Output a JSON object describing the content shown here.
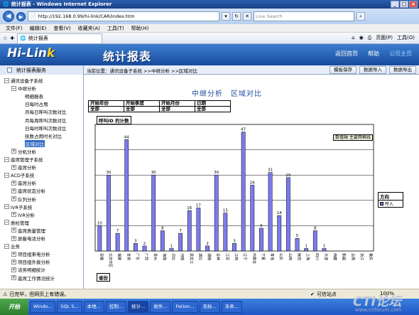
{
  "window": {
    "title": "统计报表 - Windows Internet Explorer"
  },
  "browser": {
    "url": "http://192.168.0.99/hi-link/CAR/index.htm",
    "search_placeholder": "Live Search",
    "menus": [
      "文件(F)",
      "编辑(E)",
      "查看(V)",
      "收藏夹(A)",
      "工具(T)",
      "帮助(H)"
    ],
    "tab_label": "统计报表",
    "tools": {
      "page": "页面(P)",
      "tools": "工具(O)"
    }
  },
  "app": {
    "logo_a": "Hi-Lin",
    "logo_b": "k",
    "title": "统计报表",
    "links": {
      "back": "返回首页",
      "help": "帮助",
      "home": "公司主页"
    }
  },
  "sidebar": {
    "header": "统计报表服务",
    "nodes": [
      {
        "label": "通讯设备子系统",
        "toggle": "⊟",
        "level": 0
      },
      {
        "label": "中继分析",
        "toggle": "⊟",
        "level": 1
      },
      {
        "label": "明细报表",
        "toggle": "",
        "level": 2
      },
      {
        "label": "日每时占用",
        "toggle": "",
        "level": 2
      },
      {
        "label": "月每日呼叫次数对比",
        "toggle": "",
        "level": 2
      },
      {
        "label": "月每周呼叫次数对比",
        "toggle": "",
        "level": 2
      },
      {
        "label": "日每时呼叫次数对比",
        "toggle": "",
        "level": 2
      },
      {
        "label": "统数占用时长对比",
        "toggle": "",
        "level": 2
      },
      {
        "label": "区域对比",
        "toggle": "",
        "level": 2,
        "selected": true
      },
      {
        "label": "分机分析",
        "toggle": "⊞",
        "level": 1
      },
      {
        "label": "座席管理子系统",
        "toggle": "⊟",
        "level": 0
      },
      {
        "label": "座席分析",
        "toggle": "⊞",
        "level": 1
      },
      {
        "label": "ACD子系统",
        "toggle": "⊟",
        "level": 0
      },
      {
        "label": "座席分析",
        "toggle": "⊞",
        "level": 1
      },
      {
        "label": "座席状态分析",
        "toggle": "⊞",
        "level": 1
      },
      {
        "label": "队列分析",
        "toggle": "⊞",
        "level": 1
      },
      {
        "label": "IVR子系统",
        "toggle": "⊟",
        "level": 0
      },
      {
        "label": "IVR分析",
        "toggle": "⊞",
        "level": 1
      },
      {
        "label": "质检管理",
        "toggle": "⊟",
        "level": 0
      },
      {
        "label": "座席质量管理",
        "toggle": "⊞",
        "level": 1
      },
      {
        "label": "屏蔽电话分析",
        "toggle": "⊞",
        "level": 1
      },
      {
        "label": "业务",
        "toggle": "⊟",
        "level": 0
      },
      {
        "label": "项目组来电分析",
        "toggle": "⊞",
        "level": 1
      },
      {
        "label": "项目组外拨分析",
        "toggle": "⊞",
        "level": 1
      },
      {
        "label": "话务明细统计",
        "toggle": "⊞",
        "level": 1
      },
      {
        "label": "座席工作情况统计",
        "toggle": "⊞",
        "level": 1
      }
    ]
  },
  "breadcrumb": {
    "text": "当前位置：通讯设备子系统 >>中继分析 >>区域对比"
  },
  "actions": {
    "save": "模板保存",
    "import": "数据导入",
    "export": "数据导出"
  },
  "filters": {
    "headers": [
      "开始年份",
      "开始季度",
      "开始月份",
      "日期"
    ],
    "values": [
      "全部",
      "全部",
      "全部",
      "全部"
    ]
  },
  "chart_data": {
    "type": "bar",
    "title": "中继分析　区域对比",
    "ylabel": "呼叫ID 的计数",
    "xlabel": "省份",
    "legend_title": "方向",
    "tooltip": "数值轴 主要网格线",
    "ylim": [
      0,
      50
    ],
    "grid": true,
    "series": [
      {
        "name": "呼入",
        "color": "#7b7bef"
      }
    ],
    "categories": [
      "安徽",
      "北京市区",
      "福建",
      "甘肃",
      "广东",
      "广西",
      "贵州",
      "海南",
      "河北",
      "河南",
      "黑龙江",
      "湖北",
      "湖南",
      "吉林",
      "江苏",
      "江西",
      "辽宁",
      "内蒙古",
      "宁夏",
      "青海",
      "山东",
      "山西",
      "陕西",
      "上海",
      "四川",
      "天津",
      "西藏",
      "新疆",
      "云南",
      "浙江",
      "重庆"
    ],
    "values": [
      10,
      30,
      7,
      44,
      3,
      2,
      30,
      8,
      1,
      7,
      16,
      17,
      2,
      30,
      15,
      3,
      47,
      26,
      9,
      31,
      14,
      29,
      5,
      1,
      8,
      1,
      0,
      0,
      0,
      0,
      0
    ]
  },
  "status": {
    "left": "已完毕，但网页上有错误。",
    "zone": "可信站点",
    "zoom": "100%"
  },
  "taskbar": {
    "start": "开始",
    "tasks": [
      "Windo...",
      "SQL S...",
      "本地...",
      "控制...",
      "统计...",
      "收件...",
      "Fetion...",
      "无标...",
      "未命..."
    ]
  },
  "watermark": {
    "brand": "CTI论坛",
    "url": "www.ctiforum.com"
  }
}
